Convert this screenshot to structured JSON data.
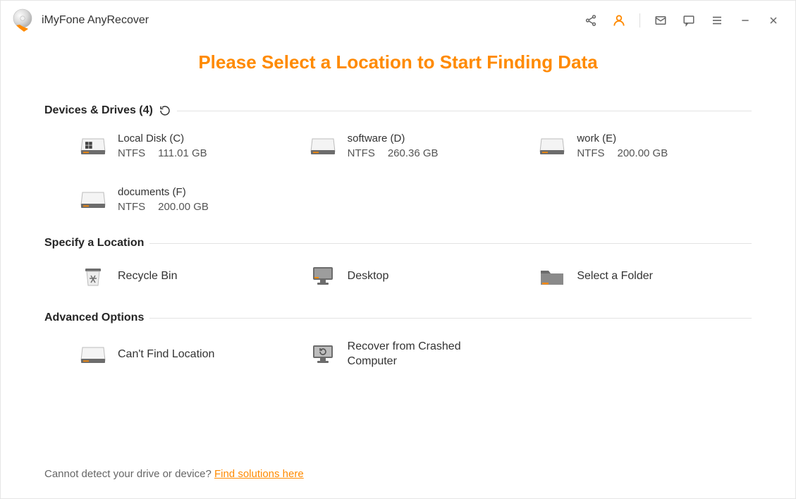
{
  "app_title": "iMyFone AnyRecover",
  "heading": "Please Select a Location to Start Finding Data",
  "sections": {
    "devices": {
      "title": "Devices & Drives (4)",
      "items": [
        {
          "name": "Local Disk (C)",
          "fs": "NTFS",
          "size": "111.01 GB"
        },
        {
          "name": "software (D)",
          "fs": "NTFS",
          "size": "260.36 GB"
        },
        {
          "name": "work (E)",
          "fs": "NTFS",
          "size": "200.00 GB"
        },
        {
          "name": "documents (F)",
          "fs": "NTFS",
          "size": "200.00 GB"
        }
      ]
    },
    "specify": {
      "title": "Specify a Location",
      "items": [
        {
          "label": "Recycle Bin"
        },
        {
          "label": "Desktop"
        },
        {
          "label": "Select a Folder"
        }
      ]
    },
    "advanced": {
      "title": "Advanced Options",
      "items": [
        {
          "label": "Can't Find Location"
        },
        {
          "label": "Recover from Crashed Computer"
        }
      ]
    }
  },
  "footer": {
    "text": "Cannot detect your drive or device? ",
    "link": "Find solutions here"
  }
}
